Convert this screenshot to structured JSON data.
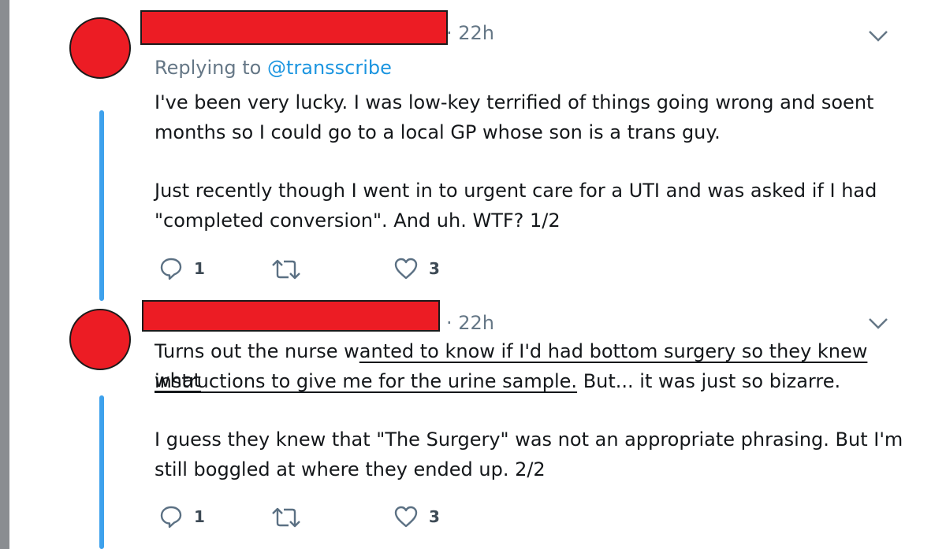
{
  "tweets": [
    {
      "time": "· 22h",
      "replying_prefix": "Replying to",
      "replying_handle": "@transscribe",
      "line1": "I've been very lucky. I was low-key terrified of things going wrong and soent",
      "line2": "months so I could go to a local GP whose son is a trans guy.",
      "line3": "Just recently though I went in to urgent care for a UTI and was asked if I had",
      "line4": "\"completed conversion\". And uh. WTF? 1/2",
      "reply_count": "1",
      "retweet_count": "",
      "like_count": "3"
    },
    {
      "time": "· 22h",
      "line1_pre": "Turns out the nurse w",
      "line1_ul": "anted to know if I'd had bottom surgery so they knew what",
      "line2_ul": "instructions to give me for the urine sample.",
      "line2_post": " But... it was just so bizarre.",
      "line3": "I guess they knew that \"The Surgery\" was not an appropriate phrasing. But I'm",
      "line4": "still boggled at where they ended up. 2/2",
      "reply_count": "1",
      "retweet_count": "",
      "like_count": "3"
    }
  ],
  "icons": {
    "reply": "speech-bubble",
    "retweet": "retweet-arrows",
    "like": "heart",
    "menu": "chevron-down"
  },
  "colors": {
    "redaction": "#ec1c24",
    "thread_line": "#3ea1ec",
    "link": "#1b95e0",
    "muted": "#657786",
    "action_icon": "#5b7083"
  }
}
